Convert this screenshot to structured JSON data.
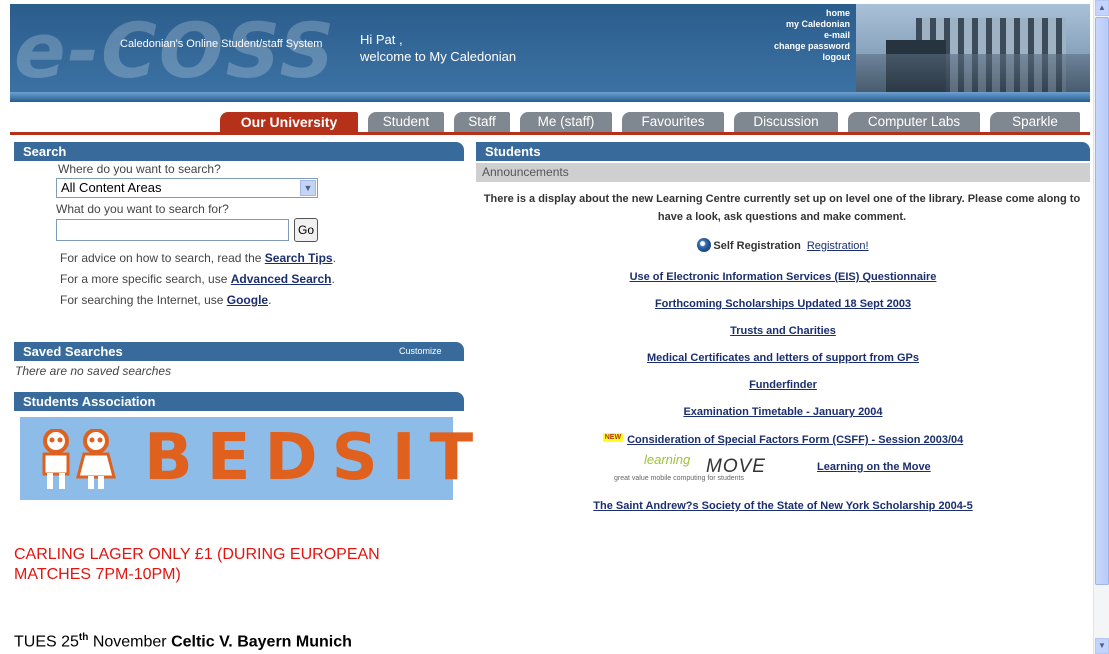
{
  "header": {
    "logo_text": "e-COSS",
    "tagline": "Caledonian's Online Student/staff System",
    "greeting_line1": "Hi Pat ,",
    "greeting_line2": "welcome to My Caledonian",
    "links": [
      "home",
      "my Caledonian",
      "e-mail",
      "change password",
      "logout"
    ]
  },
  "tabs": [
    {
      "label": "Our University",
      "active": true
    },
    {
      "label": "Student",
      "active": false
    },
    {
      "label": "Staff",
      "active": false
    },
    {
      "label": "Me (staff)",
      "active": false
    },
    {
      "label": "Favourites",
      "active": false
    },
    {
      "label": "Discussion",
      "active": false
    },
    {
      "label": "Computer Labs",
      "active": false
    },
    {
      "label": "Sparkle",
      "active": false
    }
  ],
  "search": {
    "title": "Search",
    "where_label": "Where do you want to search?",
    "where_value": "All Content Areas",
    "what_label": "What do you want to search for?",
    "query_value": "",
    "go_label": "Go",
    "tips_prefix": "For advice on how to search, read the ",
    "tips_link": "Search Tips",
    "advanced_prefix": "For a more specific search, use ",
    "advanced_link": "Advanced Search",
    "google_prefix": "For searching the Internet, use ",
    "google_link": "Google",
    "period": "."
  },
  "saved_searches": {
    "title": "Saved Searches",
    "customize_label": "Customize",
    "empty_text": "There are no saved searches"
  },
  "students_association": {
    "title": "Students Association",
    "banner_text": "BEDSIT",
    "promo": "CARLING LAGER ONLY £1 (DURING EUROPEAN MATCHES 7PM-10PM)",
    "fixture_day": "TUES 25",
    "fixture_sup": "th",
    "fixture_month": " November ",
    "fixture_match": "Celtic V. Bayern Munich"
  },
  "students": {
    "title": "Students",
    "announcements_label": "Announcements",
    "announcement_text": "There is a display about the new Learning Centre currently set up on level one of the library. Please come along to have a look, ask questions and make comment.",
    "self_registration_label": "Self Registration",
    "registration_link": "Registration!",
    "links": [
      "Use of Electronic Information Services (EIS) Questionnaire",
      "Forthcoming Scholarships Updated 18 Sept 2003",
      "Trusts and Charities",
      "Medical Certificates and letters of support from GPs",
      "Funderfinder",
      "Examination Timetable - January 2004"
    ],
    "new_badge": "NEW",
    "csff_link": "Consideration of Special Factors Form (CSFF) - Session 2003/04",
    "lotm_logo_word1": "learning",
    "lotm_logo_word2": "MOVE",
    "lotm_logo_tagline": "great value mobile computing for students",
    "lotm_link": "Learning on the Move",
    "scholarship_link": "The Saint Andrew?s Society of the State of New York Scholarship 2004-5"
  }
}
